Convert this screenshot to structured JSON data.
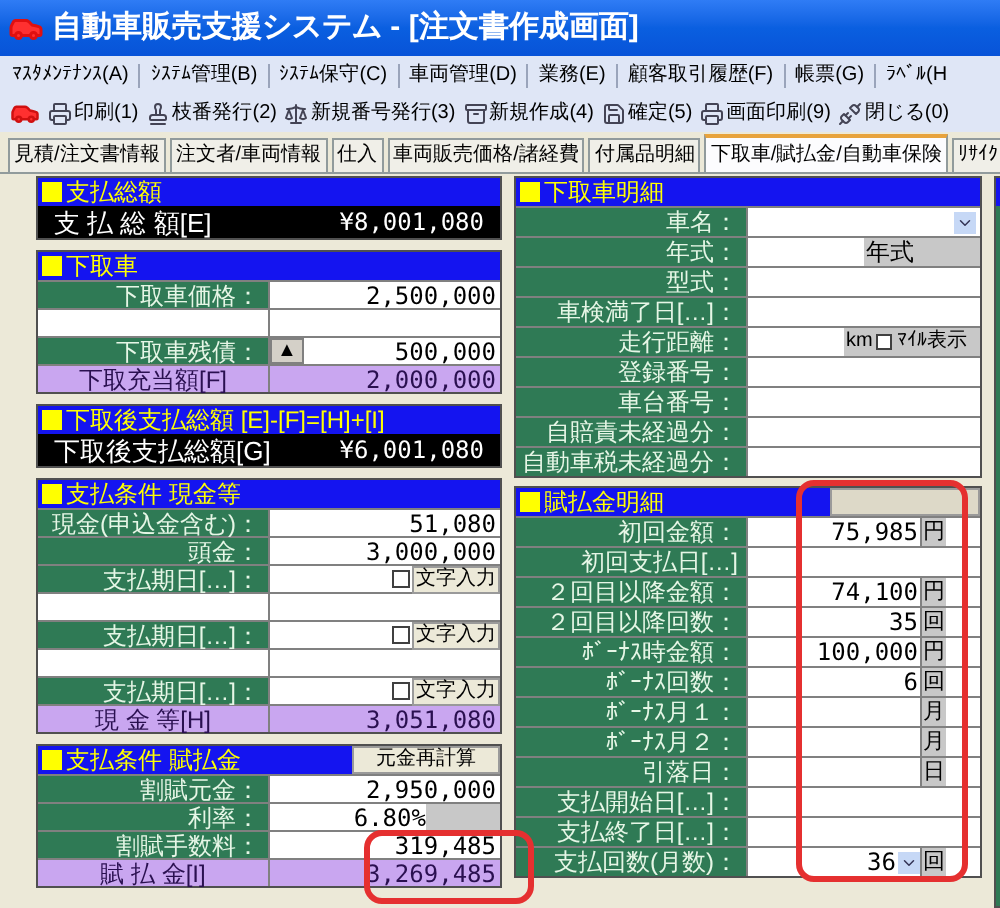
{
  "window": {
    "title": "自動車販売支援システム - [注文書作成画面]"
  },
  "menu": [
    "ﾏｽﾀﾒﾝﾃﾅﾝｽ(A)",
    "ｼｽﾃﾑ管理(B)",
    "ｼｽﾃﾑ保守(C)",
    "車両管理(D)",
    "業務(E)",
    "顧客取引履歴(F)",
    "帳票(G)",
    "ﾗﾍﾞﾙ(H"
  ],
  "toolbar": [
    "印刷(1)",
    "枝番発行(2)",
    "新規番号発行(3)",
    "新規作成(4)",
    "確定(5)",
    "画面印刷(9)",
    "閉じる(0)"
  ],
  "tabs": [
    {
      "label": "見積/注文書情報",
      "selected": false
    },
    {
      "label": "注文者/車両情報",
      "selected": false
    },
    {
      "label": "仕入",
      "selected": false
    },
    {
      "label": "車両販売価格/諸経費",
      "selected": false
    },
    {
      "label": "付属品明細",
      "selected": false
    },
    {
      "label": "下取車/賦払金/自動車保険",
      "selected": true
    },
    {
      "label": "ﾘｻｲｸ",
      "selected": false
    }
  ],
  "left_panels": [
    {
      "title": "支払総額",
      "rows": [
        {
          "kind": "total",
          "label": "支 払 総 額[E]",
          "value": "¥8,001,080"
        }
      ]
    },
    {
      "title": "下取車",
      "rows": [
        {
          "kind": "input",
          "label": "下取車価格：",
          "value": "2,500,000"
        },
        {
          "kind": "blank"
        },
        {
          "kind": "input_button",
          "label": "下取車残債：",
          "button": "▲",
          "value": "500,000"
        },
        {
          "kind": "sum",
          "label": "下取充当額[F]",
          "value": "2,000,000"
        }
      ]
    },
    {
      "title": "下取後支払総額 [E]-[F]=[H]+[I]",
      "rows": [
        {
          "kind": "total",
          "label": "下取後支払総額[G]",
          "value": "¥6,001,080"
        }
      ]
    },
    {
      "title": "支払条件 現金等",
      "rows": [
        {
          "kind": "input",
          "label": "現金(申込金含む)：",
          "value": "51,080"
        },
        {
          "kind": "input",
          "label": "頭金：",
          "value": "3,000,000"
        },
        {
          "kind": "date",
          "label": "支払期日[…]：",
          "checked": false,
          "button": "文字入力"
        },
        {
          "kind": "blank"
        },
        {
          "kind": "date",
          "label": "支払期日[…]：",
          "checked": false,
          "button": "文字入力"
        },
        {
          "kind": "blank"
        },
        {
          "kind": "date",
          "label": "支払期日[…]：",
          "checked": false,
          "button": "文字入力"
        },
        {
          "kind": "sum",
          "label": "現 金 等[H]",
          "value": "3,051,080"
        }
      ]
    },
    {
      "title": "支払条件 賦払金",
      "button": "元金再計算",
      "rows": [
        {
          "kind": "input",
          "label": "割賦元金：",
          "value": "2,950,000"
        },
        {
          "kind": "rate",
          "label": "利率：",
          "value": "6.80",
          "unit": "%"
        },
        {
          "kind": "input",
          "label": "割賦手数料：",
          "value": "319,485"
        },
        {
          "kind": "sum",
          "label": "賦 払 金[I]",
          "value": "3,269,485"
        }
      ]
    }
  ],
  "right_panels": [
    {
      "title": "下取車明細",
      "rows": [
        {
          "kind": "select",
          "label": "車名："
        },
        {
          "kind": "suffix",
          "label": "年式：",
          "suffix": "年式"
        },
        {
          "kind": "field",
          "label": "型式："
        },
        {
          "kind": "field",
          "label": "車検満了日[…]："
        },
        {
          "kind": "mileage",
          "label": "走行距離：",
          "unit": "km",
          "checked": false,
          "option": "ﾏｲﾙ表示"
        },
        {
          "kind": "field",
          "label": "登録番号："
        },
        {
          "kind": "field",
          "label": "車台番号："
        },
        {
          "kind": "field",
          "label": "自賠責未経過分："
        },
        {
          "kind": "field",
          "label": "自動車税未経過分："
        }
      ]
    },
    {
      "title": "賦払金明細",
      "has_button": true,
      "rows": [
        {
          "kind": "field",
          "label": "初回金額：",
          "value": "75,985",
          "unit": "円"
        },
        {
          "kind": "field",
          "label": "初回支払日[…]"
        },
        {
          "kind": "field",
          "label": "２回目以降金額：",
          "value": "74,100",
          "unit": "円"
        },
        {
          "kind": "field",
          "label": "２回目以降回数：",
          "value": "35",
          "unit": "回"
        },
        {
          "kind": "field",
          "label": "ﾎﾞｰﾅｽ時金額：",
          "value": "100,000",
          "unit": "円"
        },
        {
          "kind": "field",
          "label": "ﾎﾞｰﾅｽ回数：",
          "value": "6",
          "unit": "回"
        },
        {
          "kind": "field",
          "label": "ﾎﾞｰﾅｽ月１：",
          "unit": "月"
        },
        {
          "kind": "field",
          "label": "ﾎﾞｰﾅｽ月２：",
          "unit": "月"
        },
        {
          "kind": "field",
          "label": "引落日：",
          "unit": "日"
        },
        {
          "kind": "field",
          "label": "支払開始日[…]："
        },
        {
          "kind": "field",
          "label": "支払終了日[…]："
        },
        {
          "kind": "select_unit",
          "label": "支払回数(月数)：",
          "value": "36",
          "unit": "回"
        }
      ]
    }
  ]
}
